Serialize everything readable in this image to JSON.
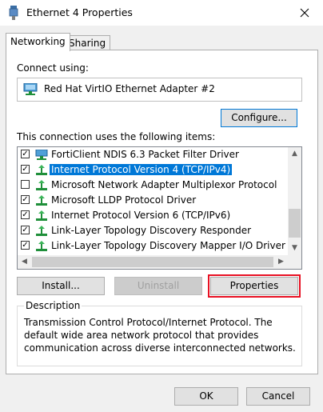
{
  "window": {
    "title": "Ethernet 4 Properties"
  },
  "tabs": [
    {
      "label": "Networking"
    },
    {
      "label": "Sharing"
    }
  ],
  "connect_using": {
    "label": "Connect using:",
    "adapter": "Red Hat VirtIO Ethernet Adapter #2",
    "configure_label": "Configure..."
  },
  "items_section": {
    "label": "This connection uses the following items:",
    "items": [
      {
        "label": "FortiClient NDIS 6.3 Packet Filter Driver",
        "checked": true,
        "selected": false,
        "icon": "network-adapter-icon"
      },
      {
        "label": "Internet Protocol Version 4 (TCP/IPv4)",
        "checked": true,
        "selected": true,
        "icon": "protocol-icon"
      },
      {
        "label": "Microsoft Network Adapter Multiplexor Protocol",
        "checked": false,
        "selected": false,
        "icon": "protocol-icon"
      },
      {
        "label": "Microsoft LLDP Protocol Driver",
        "checked": true,
        "selected": false,
        "icon": "protocol-icon"
      },
      {
        "label": "Internet Protocol Version 6 (TCP/IPv6)",
        "checked": true,
        "selected": false,
        "icon": "protocol-icon"
      },
      {
        "label": "Link-Layer Topology Discovery Responder",
        "checked": true,
        "selected": false,
        "icon": "protocol-icon"
      },
      {
        "label": "Link-Layer Topology Discovery Mapper I/O Driver",
        "checked": true,
        "selected": false,
        "icon": "protocol-icon"
      }
    ]
  },
  "item_buttons": {
    "install": "Install...",
    "uninstall": "Uninstall",
    "properties": "Properties"
  },
  "description": {
    "title": "Description",
    "text": "Transmission Control Protocol/Internet Protocol. The default wide area network protocol that provides communication across diverse interconnected networks."
  },
  "footer": {
    "ok": "OK",
    "cancel": "Cancel"
  },
  "colors": {
    "selection": "#0078d7",
    "highlight_border": "#e81123",
    "focus_border": "#0078d7"
  }
}
